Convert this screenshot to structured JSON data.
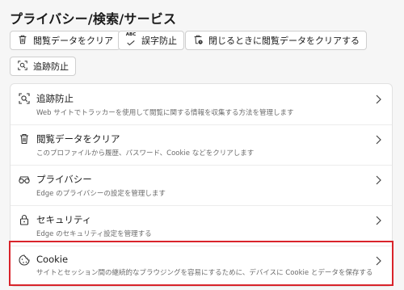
{
  "page": {
    "title": "プライバシー/検索/サービス"
  },
  "toolbar": {
    "clear_browsing_data": "閲覧データをクリア",
    "spell_prevention": "誤字防止",
    "clear_on_close": "閉じるときに閲覧データをクリアする",
    "tracking_prevention": "追跡防止",
    "abc_glyph": "ABC"
  },
  "settings": {
    "items": [
      {
        "icon": "tracking-icon",
        "label": "追跡防止",
        "desc": "Web サイトでトラッカーを使用して閲覧に関する情報を収集する方法を管理します"
      },
      {
        "icon": "trash-icon",
        "label": "閲覧データをクリア",
        "desc": "このプロファイルから履歴、パスワード、Cookie などをクリアします"
      },
      {
        "icon": "privacy-icon",
        "label": "プライバシー",
        "desc": "Edge のプライバシーの設定を管理します"
      },
      {
        "icon": "lock-icon",
        "label": "セキュリティ",
        "desc": "Edge のセキュリティ設定を管理する"
      },
      {
        "icon": "cookie-icon",
        "label": "Cookie",
        "desc": "サイトとセッション間の継続的なブラウジングを容易にするために、デバイスに Cookie とデータを保存する"
      }
    ]
  },
  "colors": {
    "highlight": "#d9242b",
    "background": "#f6f6f6"
  }
}
